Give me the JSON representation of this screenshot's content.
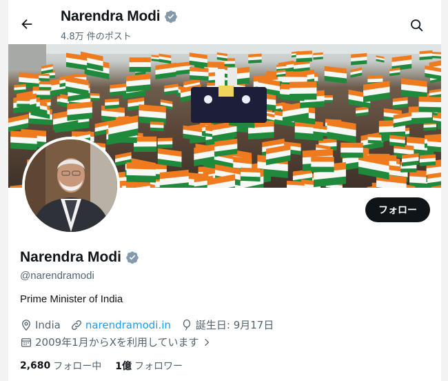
{
  "header": {
    "title": "Narendra Modi",
    "post_count": "4.8万 件のポスト"
  },
  "profile": {
    "name": "Narendra Modi",
    "handle": "@narendramodi",
    "bio": "Prime Minister of India",
    "location": "India",
    "website": "narendramodi.in",
    "birthday": "誕生日: 9月17日",
    "joined": "2009年1月からXを利用しています",
    "follow_label": "フォロー",
    "following_count": "2,680",
    "following_label": "フォロー中",
    "followers_count": "1億",
    "followers_label": "フォロワー"
  },
  "icons": {
    "back": "back-arrow-icon",
    "search": "search-icon",
    "verified": "verified-badge-icon",
    "location": "location-pin-icon",
    "link": "link-icon",
    "birthday": "balloon-icon",
    "calendar": "calendar-icon"
  },
  "colors": {
    "verified": "#829aab",
    "link": "#1d9bf0",
    "button": "#0f1419",
    "secondary_text": "#536471"
  }
}
